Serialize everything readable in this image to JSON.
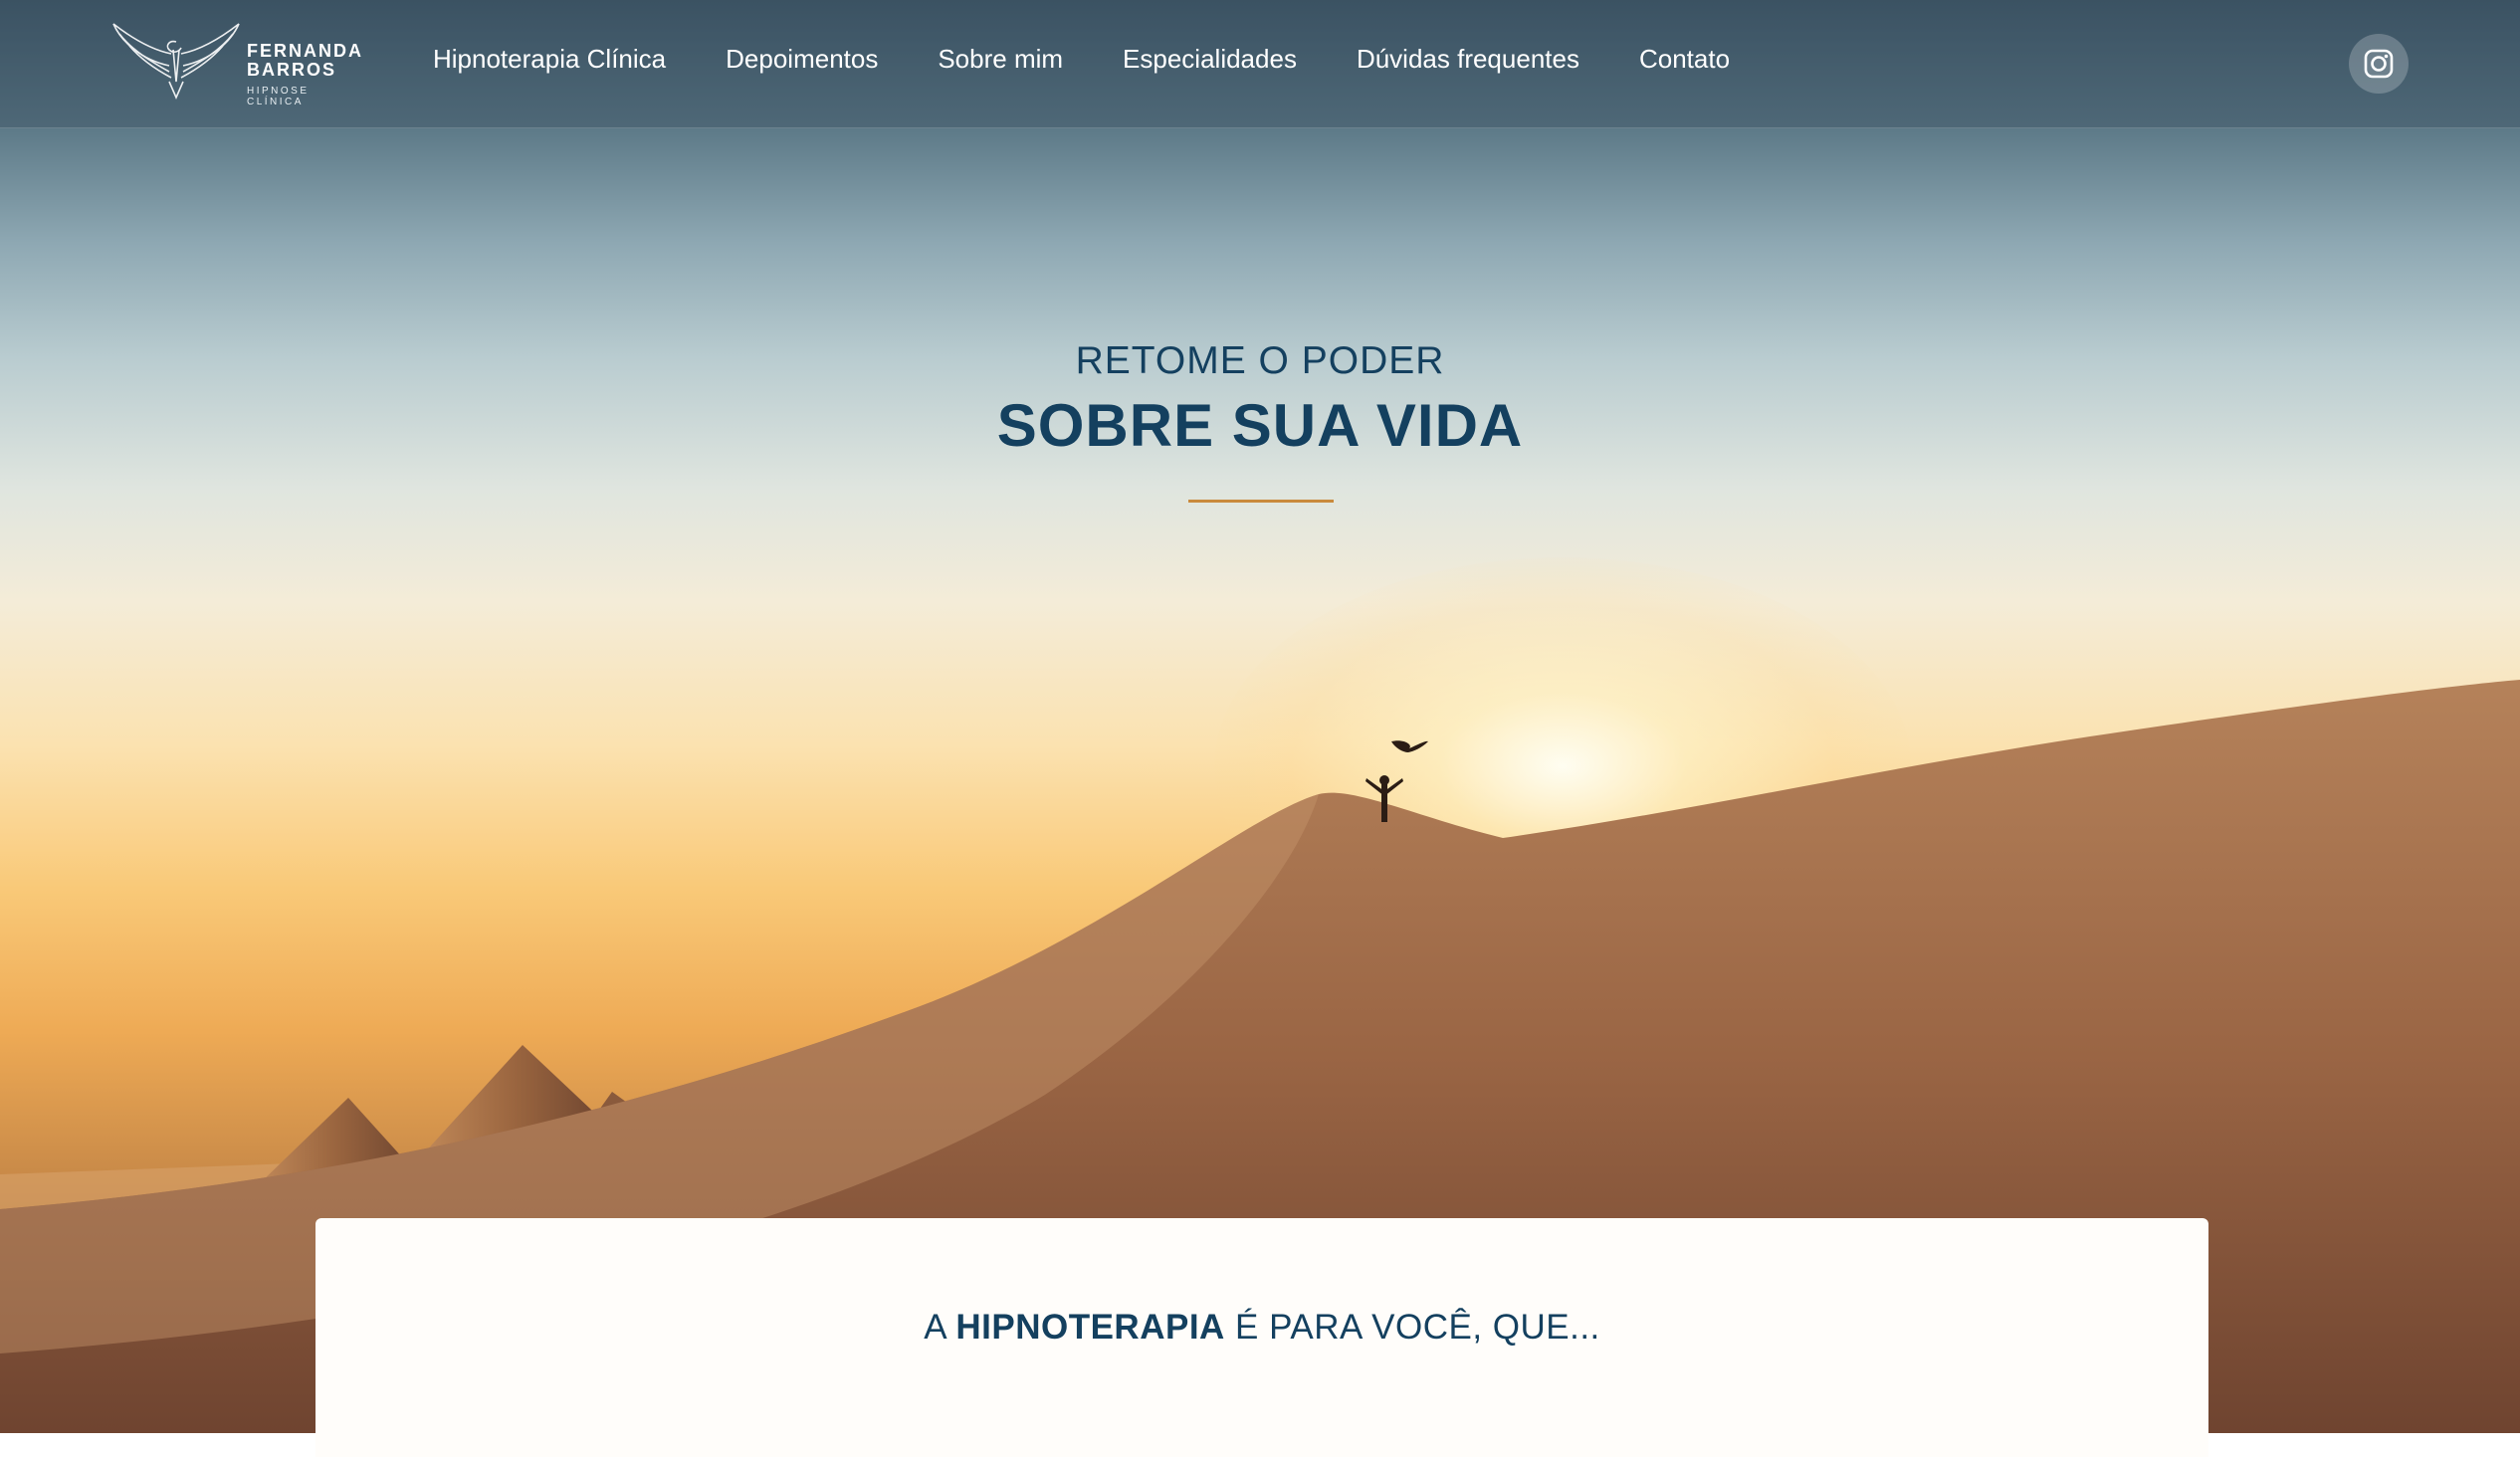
{
  "brand": {
    "line1": "FERNANDA",
    "line2": "BARROS",
    "tagline": "HIPNOSE CLÍNICA"
  },
  "nav": {
    "items": [
      {
        "label": "Hipnoterapia Clínica"
      },
      {
        "label": "Depoimentos"
      },
      {
        "label": "Sobre mim"
      },
      {
        "label": "Especialidades"
      },
      {
        "label": "Dúvidas frequentes"
      },
      {
        "label": "Contato"
      }
    ],
    "social_icon": "instagram-icon"
  },
  "hero": {
    "eyebrow": "RETOME O PODER",
    "headline": "SOBRE SUA VIDA"
  },
  "intro_card": {
    "prefix": "A ",
    "emphasis": "HIPNOTERAPIA",
    "suffix": " É PARA VOCÊ, QUE..."
  },
  "colors": {
    "primary": "#14405f",
    "accent": "#c98a3c",
    "nav_text": "#ffffff"
  }
}
